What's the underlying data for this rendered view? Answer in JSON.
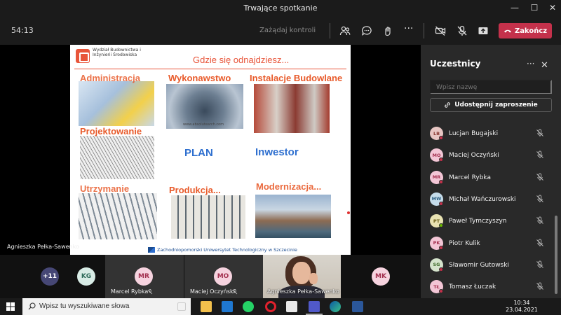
{
  "window": {
    "title": "Trwające spotkanie",
    "minimize": "—",
    "maximize": "☐",
    "close": "✕"
  },
  "controls": {
    "timer": "54:13",
    "request_control": "Zażądaj kontroli",
    "end_call": "Zakończ",
    "end_color": "#c4314b"
  },
  "slide": {
    "faculty": "Wydział Budownictwa i Inżynierii Środowiska",
    "title": "Gdzie się odnajdziesz...",
    "cells": {
      "administracja": "Administracja",
      "wykonawstwo": "Wykonawstwo",
      "instalacje": "Instalacje Budowlane",
      "projektowanie": "Projektowanie",
      "plan": "PLAN",
      "inwestor": "Inwestor",
      "utrzymanie": "Utrzymanie",
      "produkcja": "Produkcja...",
      "modernizacja": "Modernizacja..."
    },
    "watermark": "www.absolutearch.com",
    "footer": "Zachodniopomorski Uniwersytet Technologiczny w Szczecinie",
    "accent": "#e8553a"
  },
  "presenter_label": "Agnieszka Pełka-Sawenko",
  "panel": {
    "title": "Uczestnicy",
    "more": "···",
    "close": "✕",
    "search_placeholder": "Wpisz nazwę",
    "share_invite": "Udostępnij zaproszenie",
    "participants": [
      {
        "initials": "LB",
        "name": "Lucjan Bugajski",
        "bg": "#e7c6c3",
        "fg": "#8a3b34",
        "status": "#c4314b"
      },
      {
        "initials": "MO",
        "name": "Maciej Oczyński",
        "bg": "#f3c6d6",
        "fg": "#a3304f",
        "status": "#c4314b"
      },
      {
        "initials": "MR",
        "name": "Marcel Rybka",
        "bg": "#f3c6d6",
        "fg": "#a3304f",
        "status": "#c4314b"
      },
      {
        "initials": "MW",
        "name": "Michał Wańczurowski",
        "bg": "#c5dcea",
        "fg": "#2c5f82",
        "status": "#c4314b"
      },
      {
        "initials": "PT",
        "name": "Paweł Tymczyszyn",
        "bg": "#e9e2b2",
        "fg": "#6b5f18",
        "status": "#6bb700"
      },
      {
        "initials": "PK",
        "name": "Piotr Kulik",
        "bg": "#f3c6d6",
        "fg": "#a3304f",
        "status": "#c4314b"
      },
      {
        "initials": "SG",
        "name": "Sławomir Gutowski",
        "bg": "#d5e4cc",
        "fg": "#3f6b2a",
        "status": "#c4314b"
      },
      {
        "initials": "TŁ",
        "name": "Tomasz Łuczak",
        "bg": "#f3c6d6",
        "fg": "#a3304f",
        "status": "#c4314b"
      }
    ]
  },
  "gallery": {
    "more_count": "+11",
    "tiles": [
      {
        "initials": "KG",
        "name": "",
        "bg": "#d8ece6",
        "fg": "#2e6b5a"
      },
      {
        "initials": "MR",
        "name": "Marcel Rybka",
        "bg": "#f6d3df",
        "fg": "#a3304f"
      },
      {
        "initials": "MO",
        "name": "Maciej Oczyński",
        "bg": "#f6d3df",
        "fg": "#a3304f"
      },
      {
        "initials": "",
        "name": "Agnieszka Pełka-Sawenko",
        "bg": "",
        "fg": ""
      },
      {
        "initials": "MK",
        "name": "",
        "bg": "#f6d3df",
        "fg": "#a3304f"
      }
    ]
  },
  "taskbar": {
    "search_placeholder": "Wpisz tu wyszukiwane słowa",
    "time": "10:34",
    "date": "23.04.2021",
    "icons": [
      "task-view-icon",
      "file-explorer-icon",
      "mail-icon",
      "whatsapp-icon",
      "opera-icon",
      "store-icon",
      "teams-icon",
      "edge-icon",
      "word-icon"
    ]
  }
}
